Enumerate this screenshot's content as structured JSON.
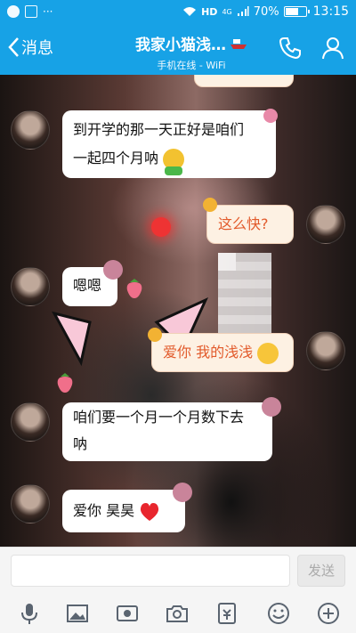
{
  "status_bar": {
    "network_label": "HD",
    "signal_label": "4G",
    "battery": "70%",
    "battery_level": 0.7,
    "time": "13:15",
    "more_label": "···"
  },
  "header": {
    "back_label": "消息",
    "title": "我家小猫浅…",
    "subtitle": "手机在线 - WiFi"
  },
  "messages": [
    {
      "side": "left",
      "lines": [
        "到开学的那一天正好是咱们",
        "一起四个月呐"
      ]
    },
    {
      "side": "right",
      "text": "这么快?"
    },
    {
      "side": "left",
      "text": "嗯嗯"
    },
    {
      "side": "right",
      "text": "爱你 我的浅浅"
    },
    {
      "side": "left",
      "lines": [
        "咱们要一个月一个月数下去",
        "呐"
      ]
    },
    {
      "side": "left",
      "text": "爱你 昊昊"
    }
  ],
  "input": {
    "placeholder": "",
    "send_label": "发送"
  },
  "toolbar": {
    "icons": [
      "mic-icon",
      "image-icon",
      "video-icon",
      "camera-icon",
      "red-packet-icon",
      "emoji-icon",
      "plus-icon"
    ]
  },
  "colors": {
    "accent": "#17a2e6",
    "right_bubble_text": "#e25a2b"
  }
}
